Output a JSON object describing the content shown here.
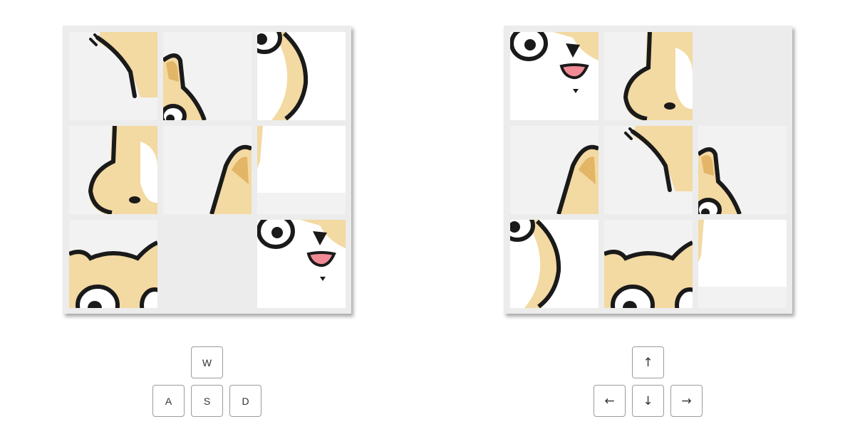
{
  "player1": {
    "keys": {
      "up": "W",
      "left": "A",
      "down": "S",
      "right": "D"
    },
    "tiles": [
      "piece-2",
      "piece-3",
      "piece-4",
      "piece-5",
      "piece-6",
      "piece-7",
      "piece-8",
      "empty",
      "piece-9"
    ]
  },
  "player2": {
    "keys": {
      "up": "↑",
      "left": "←",
      "down": "↓",
      "right": "→"
    },
    "tiles": [
      "piece-9",
      "piece-5",
      "empty",
      "piece-6",
      "piece-2",
      "piece-3",
      "piece-4",
      "piece-8",
      "piece-7"
    ]
  },
  "colors": {
    "board": "#ececec",
    "tile": "#f2f2f2",
    "fur": "#f3d9a2",
    "ear_inner": "#e3b566",
    "outline": "#1a1a1a",
    "tongue": "#f08a94"
  }
}
